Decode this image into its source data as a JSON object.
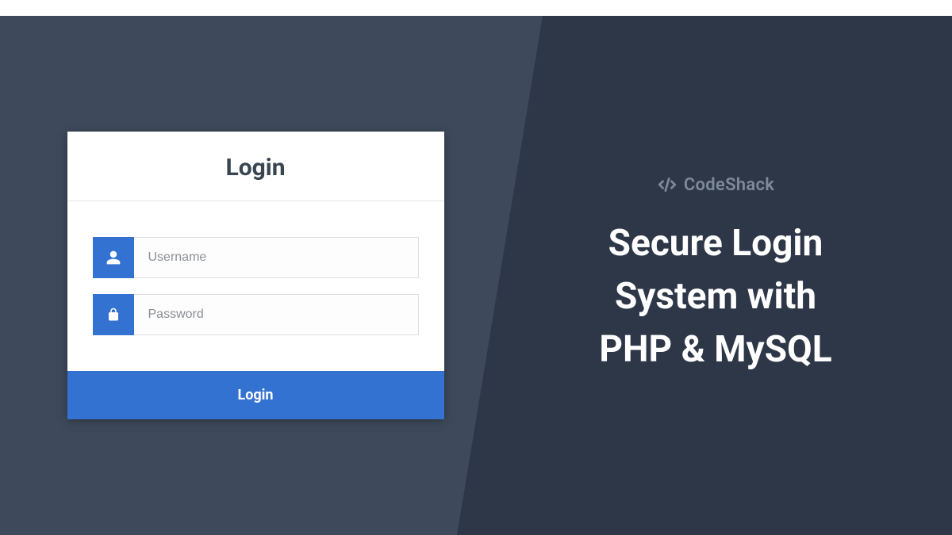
{
  "login": {
    "title": "Login",
    "username_placeholder": "Username",
    "password_placeholder": "Password",
    "submit_label": "Login"
  },
  "brand": {
    "name": "CodeShack"
  },
  "headline": {
    "line1": "Secure Login",
    "line2": "System with",
    "line3": "PHP & MySQL"
  }
}
